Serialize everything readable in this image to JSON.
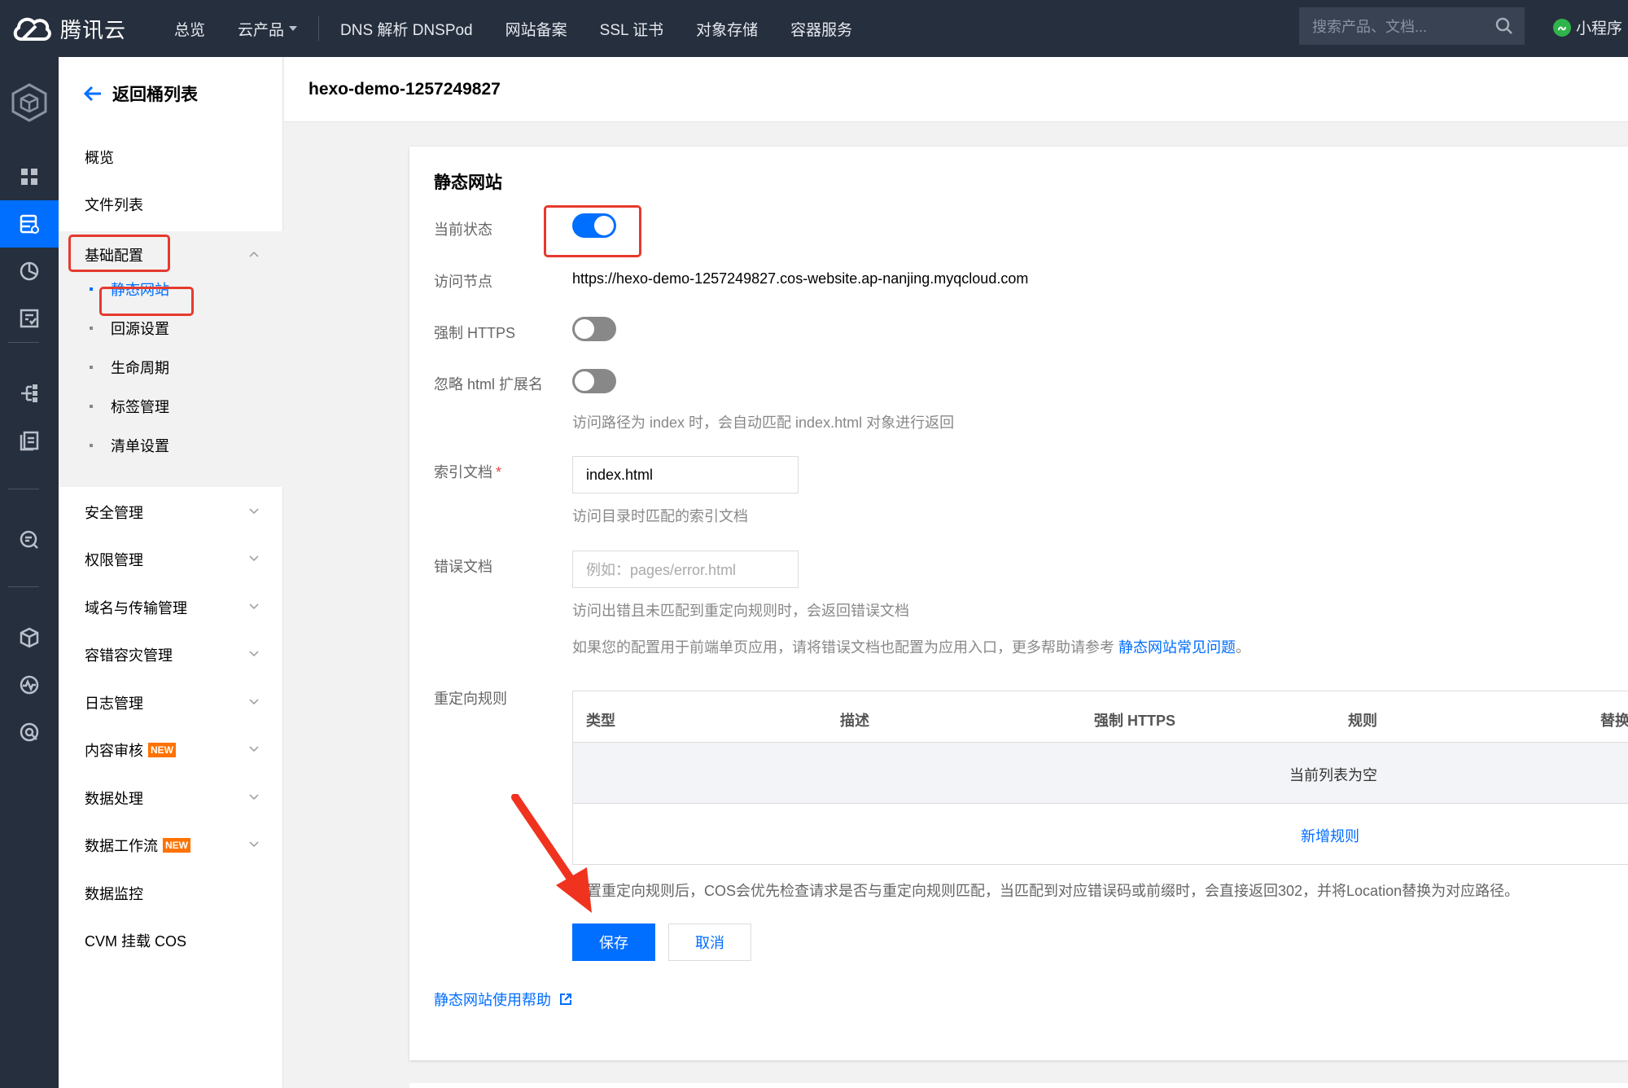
{
  "topbar": {
    "brand": "腾讯云",
    "nav": [
      "总览",
      "云产品",
      "DNS 解析 DNSPod",
      "网站备案",
      "SSL 证书",
      "对象存储",
      "容器服务"
    ],
    "search_placeholder": "搜索产品、文档...",
    "mini_program": "小程序"
  },
  "sidebar": {
    "back_label": "返回桶列表",
    "items_top": [
      "概览",
      "文件列表"
    ],
    "group_label": "基础配置",
    "sub_items": [
      "静态网站",
      "回源设置",
      "生命周期",
      "标签管理",
      "清单设置"
    ],
    "items_bottom": [
      {
        "label": "安全管理",
        "badge": ""
      },
      {
        "label": "权限管理",
        "badge": ""
      },
      {
        "label": "域名与传输管理",
        "badge": ""
      },
      {
        "label": "容错容灾管理",
        "badge": ""
      },
      {
        "label": "日志管理",
        "badge": ""
      },
      {
        "label": "内容审核",
        "badge": "NEW"
      },
      {
        "label": "数据处理",
        "badge": ""
      },
      {
        "label": "数据工作流",
        "badge": "NEW"
      },
      {
        "label": "数据监控",
        "badge": ""
      },
      {
        "label": "CVM 挂载 COS",
        "badge": ""
      }
    ]
  },
  "header": {
    "bucket_name": "hexo-demo-1257249827"
  },
  "form": {
    "section_title": "静态网站",
    "status_label": "当前状态",
    "status_on": true,
    "endpoint_label": "访问节点",
    "endpoint_value": "https://hexo-demo-1257249827.cos-website.ap-nanjing.myqcloud.com",
    "https_label": "强制 HTTPS",
    "https_on": false,
    "ignore_ext_label": "忽略 html 扩展名",
    "ignore_ext_on": false,
    "ignore_ext_hint": "访问路径为 index 时，会自动匹配 index.html 对象进行返回",
    "index_label": "索引文档",
    "index_required": "*",
    "index_value": "index.html",
    "index_hint": "访问目录时匹配的索引文档",
    "error_label": "错误文档",
    "error_placeholder": "例如：pages/error.html",
    "error_hint": "访问出错且未匹配到重定向规则时，会返回错误文档",
    "spa_hint": "如果您的配置用于前端单页应用，请将错误文档也配置为应用入口，更多帮助请参考",
    "spa_link": "静态网站常见问题",
    "spa_end": "。",
    "redirect_label": "重定向规则",
    "table_headers": [
      "类型",
      "描述",
      "强制 HTTPS",
      "规则",
      "替换"
    ],
    "table_empty": "当前列表为空",
    "add_rule": "新增规则",
    "redirect_hint": "置重定向规则后，COS会优先检查请求是否与重定向规则匹配，当匹配到对应错误码或前缀时，会直接返回302，并将Location替换为对应路径。",
    "save_label": "保存",
    "cancel_label": "取消",
    "help_label": "静态网站使用帮助"
  },
  "colors": {
    "primary": "#006eff",
    "highlight": "#e63a2e",
    "topbar": "#262f3e"
  }
}
